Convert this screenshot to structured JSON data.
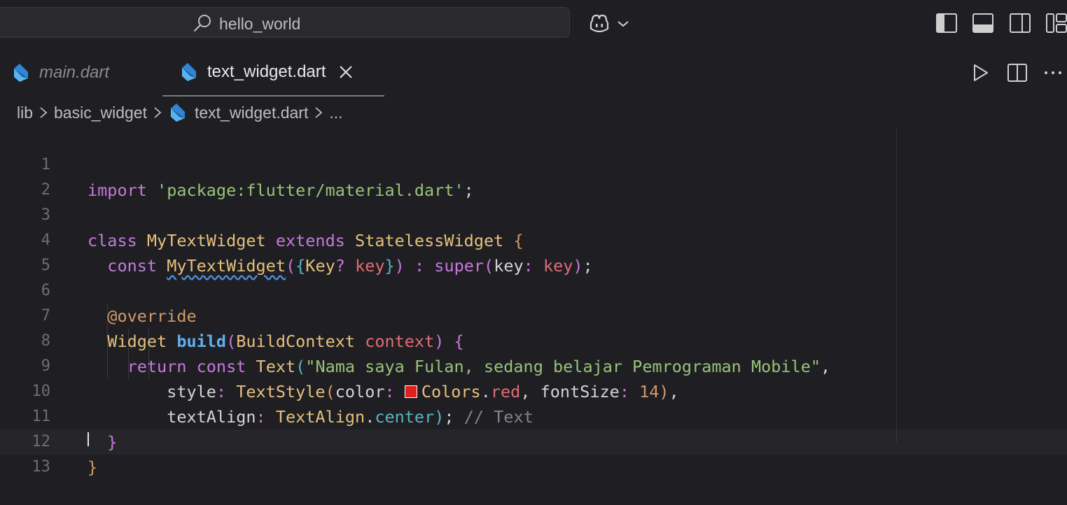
{
  "titlebar": {
    "search_text": "hello_world"
  },
  "tabs": [
    {
      "label": "main.dart",
      "active": false
    },
    {
      "label": "text_widget.dart",
      "active": true
    }
  ],
  "breadcrumb": {
    "part1": "lib",
    "part2": "basic_widget",
    "part3": "text_widget.dart",
    "part4": "..."
  },
  "editor": {
    "line_numbers": [
      "1",
      "2",
      "3",
      "4",
      "5",
      "6",
      "7",
      "8",
      "9",
      "10",
      "11",
      "12",
      "13"
    ]
  },
  "colors": {
    "background": "#1f1f23",
    "keyword": "#c678dd",
    "string": "#98c379",
    "class": "#e5c07b",
    "swatch": "#e0201c"
  }
}
